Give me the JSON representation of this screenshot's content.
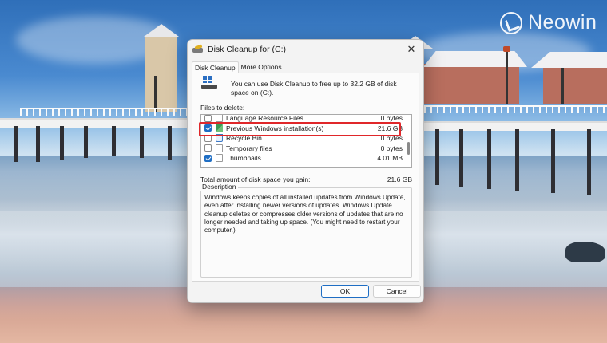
{
  "watermark": {
    "text": "Neowin"
  },
  "dialog": {
    "title": "Disk Cleanup for  (C:)",
    "close_glyph": "✕",
    "tabs": [
      {
        "label": "Disk Cleanup",
        "active": true
      },
      {
        "label": "More Options",
        "active": false
      }
    ],
    "intro": "You can use Disk Cleanup to free up to 32.2 GB of disk space on (C:).",
    "files_label": "Files to delete:",
    "files": [
      {
        "name": "Language Resource Files",
        "size": "0 bytes",
        "checked": false,
        "icon": "document-icon"
      },
      {
        "name": "Previous Windows installation(s)",
        "size": "21.6 GB",
        "checked": true,
        "icon": "windows-install-icon",
        "highlighted": true
      },
      {
        "name": "Recycle Bin",
        "size": "0 bytes",
        "checked": false,
        "icon": "recycle-bin-icon"
      },
      {
        "name": "Temporary files",
        "size": "0 bytes",
        "checked": false,
        "icon": "document-icon"
      },
      {
        "name": "Thumbnails",
        "size": "4.01 MB",
        "checked": true,
        "icon": "document-icon"
      }
    ],
    "total_label": "Total amount of disk space you gain:",
    "total_value": "21.6 GB",
    "description_label": "Description",
    "description": "Windows keeps copies of all installed updates from Windows Update, even after installing newer versions of updates. Windows Update cleanup deletes or compresses older versions of updates that are no longer needed and taking up space. (You might need to restart your computer.)",
    "ok_label": "OK",
    "cancel_label": "Cancel"
  },
  "colors": {
    "accent": "#1f6ec4",
    "highlight": "#e0272a"
  }
}
